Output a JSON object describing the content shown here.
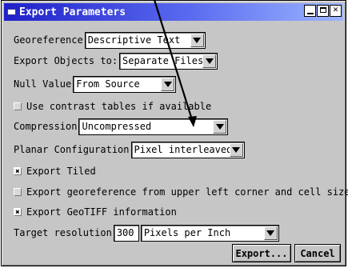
{
  "window": {
    "title": "Export Parameters"
  },
  "georeference": {
    "label": "Georeference",
    "value": "Descriptive Text"
  },
  "export_objects": {
    "label": "Export Objects to:",
    "value": "Separate Files"
  },
  "null_value": {
    "label": "Null Value",
    "value": "From Source"
  },
  "contrast": {
    "label": "Use contrast tables if available",
    "checked": false
  },
  "compression": {
    "label": "Compression",
    "value": "Uncompressed"
  },
  "planar": {
    "label": "Planar Configuration",
    "value": "Pixel interleaved"
  },
  "export_tiled": {
    "label": "Export Tiled",
    "checked": true
  },
  "georef_corner": {
    "label": "Export georeference from upper left corner and cell size",
    "checked": false
  },
  "geotiff": {
    "label": "Export GeoTIFF information",
    "checked": true
  },
  "target_resolution": {
    "label": "Target resolution",
    "value": "300",
    "unit": "Pixels per Inch"
  },
  "buttons": {
    "export": "Export...",
    "cancel": "Cancel"
  }
}
